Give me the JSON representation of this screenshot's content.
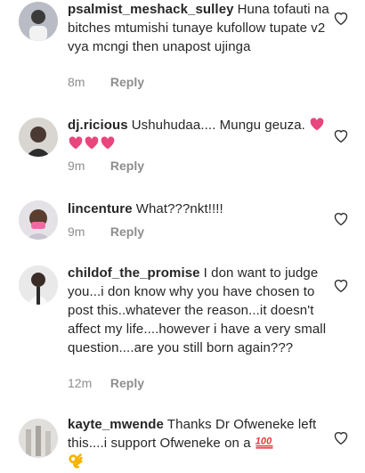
{
  "colors": {
    "text": "#262626",
    "muted": "#8e8e8e",
    "emoji_heart": "#e8467c",
    "hundred": "#e53935",
    "hand": "#f4b400"
  },
  "comments": [
    {
      "username": "psalmist_meshack_sulley",
      "text": "Huna tofauti na bitches mtumishi tunaye kufollow tupate v2 vya mcngi then unapost ujinga",
      "time": "8m",
      "reply": "Reply",
      "avatar": "person-icon"
    },
    {
      "username": "dj.ricious",
      "text": "Ushuhudaa.... Mungu geuza.",
      "emojis": [
        "pink-heart",
        "pink-heart",
        "pink-heart",
        "pink-heart"
      ],
      "time": "9m",
      "reply": "Reply",
      "avatar": "person-icon"
    },
    {
      "username": "lincenture",
      "text": "What???nkt!!!!",
      "time": "9m",
      "reply": "Reply",
      "avatar": "person-icon"
    },
    {
      "username": "childof_the_promise",
      "text": "I don want to judge you...i don know why you have chosen to post this..whatever the reason...it doesn't affect my life....however i have a very small question....are you still born again???",
      "time": "12m",
      "reply": "Reply",
      "avatar": "person-icon"
    },
    {
      "username": "kayte_mwende",
      "text": "Thanks Dr Ofweneke left this....i support Ofweneke on a",
      "emojis": [
        "hundred-points",
        "ok-hand"
      ],
      "time": "",
      "reply": "",
      "avatar": "person-icon"
    }
  ],
  "like_icon": "heart-outline-icon"
}
